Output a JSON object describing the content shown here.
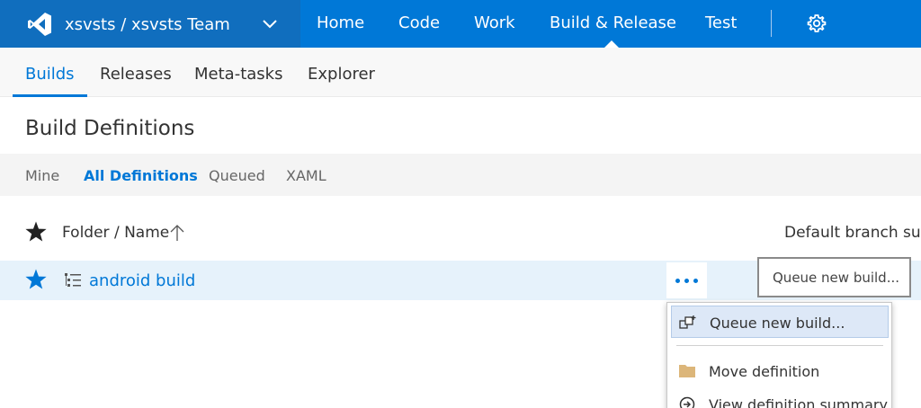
{
  "header": {
    "project_name": "xsvsts / xsvsts Team",
    "nav": [
      "Home",
      "Code",
      "Work",
      "Build & Release",
      "Test"
    ],
    "active_nav": "Build & Release",
    "accent_color": "#0078d7"
  },
  "subnav": {
    "items": [
      "Builds",
      "Releases",
      "Meta-tasks",
      "Explorer"
    ],
    "active": "Builds"
  },
  "page": {
    "title": "Build Definitions"
  },
  "filters": {
    "items": [
      "Mine",
      "All Definitions",
      "Queued",
      "XAML"
    ],
    "active": "All Definitions"
  },
  "table": {
    "columns": {
      "name": "Folder / Name",
      "branch": "Default branch sum"
    },
    "rows": [
      {
        "name": "android build",
        "action": "Queue new build..."
      }
    ]
  },
  "context_menu": {
    "items": [
      {
        "label": "Queue new build...",
        "icon": "queue-build-icon"
      },
      {
        "label": "Move definition",
        "icon": "folder-icon"
      },
      {
        "label": "View definition summary",
        "icon": "view-summary-icon"
      }
    ]
  }
}
